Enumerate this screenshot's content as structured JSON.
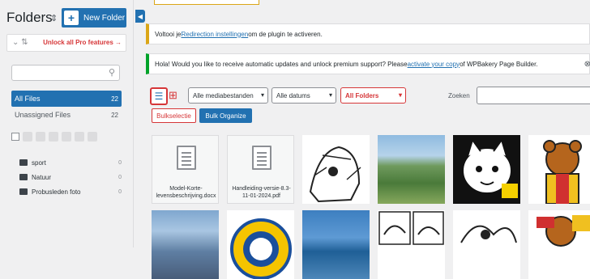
{
  "sidebar": {
    "title": "Folders",
    "new_folder_label": "New Folder",
    "unlock_pro_label": "Unlock all Pro features →",
    "search_placeholder": "",
    "nav": [
      {
        "label": "All Files",
        "count": "22",
        "active": true
      },
      {
        "label": "Unassigned Files",
        "count": "22",
        "active": false
      }
    ],
    "folders": [
      {
        "name": "sport",
        "count": "0"
      },
      {
        "name": "Natuur",
        "count": "0"
      },
      {
        "name": "Probusleden foto",
        "count": "0"
      }
    ]
  },
  "notices": {
    "setup_prefix": "Voltooi je ",
    "setup_link": "Redirection instellingen",
    "setup_suffix": " om de plugin te activeren.",
    "wpb_prefix": "Hola! Would you like to receive automatic updates and unlock premium support? Please ",
    "wpb_link": "activate your copy",
    "wpb_suffix": " of WPBakery Page Builder."
  },
  "filters": {
    "media_type": "Alle mediabestanden",
    "dates": "Alle datums",
    "folders": "All Folders",
    "search_label": "Zoeken",
    "bulk_select_label": "Bulkselectie",
    "bulk_organize_label": "Bulk Organize"
  },
  "media": [
    {
      "type": "doc",
      "name": "Model-Korte-levensbeschrijving.docx"
    },
    {
      "type": "doc",
      "name": "Handleiding-versie-8.3-11-01-2024.pdf"
    },
    {
      "type": "image",
      "kind": "sketch"
    },
    {
      "type": "image",
      "kind": "lake"
    },
    {
      "type": "image",
      "kind": "cat"
    },
    {
      "type": "image",
      "kind": "bear"
    },
    {
      "type": "image",
      "kind": "mountain"
    },
    {
      "type": "image",
      "kind": "badge"
    },
    {
      "type": "image",
      "kind": "sea"
    },
    {
      "type": "image",
      "kind": "sketch"
    },
    {
      "type": "image",
      "kind": "sketch"
    },
    {
      "type": "image",
      "kind": "bear"
    }
  ],
  "colors": {
    "accent": "#2271b1",
    "highlight": "#d63638",
    "notice_warning": "#dba617",
    "notice_success": "#00a32a"
  }
}
